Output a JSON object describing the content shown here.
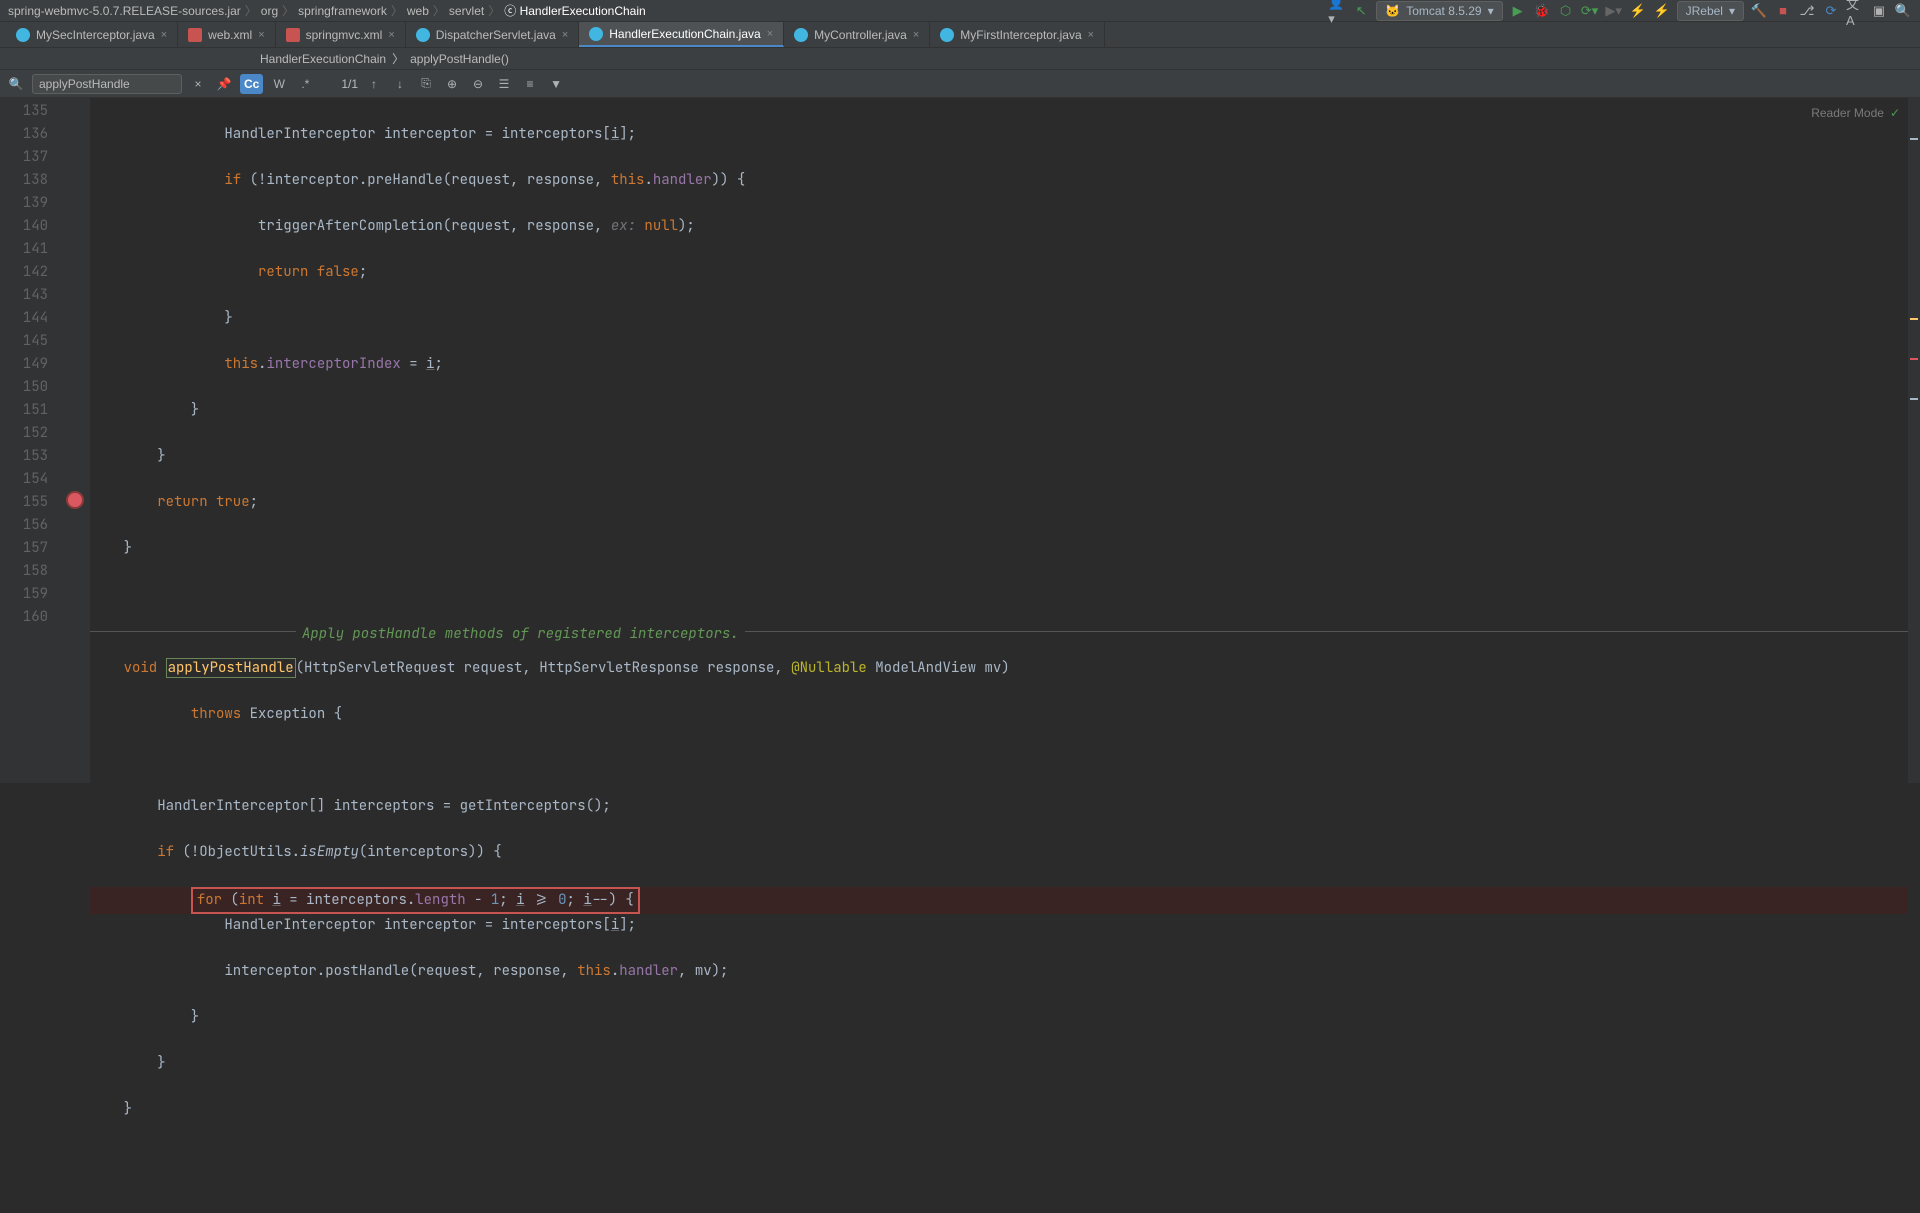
{
  "breadcrumbs": [
    "spring-webmvc-5.0.7.RELEASE-sources.jar",
    "org",
    "springframework",
    "web",
    "servlet",
    "HandlerExecutionChain"
  ],
  "run_config": "Tomcat 8.5.29",
  "jrebel_label": "JRebel",
  "tabs": [
    {
      "label": "MySecInterceptor.java",
      "icon": "java"
    },
    {
      "label": "web.xml",
      "icon": "xml"
    },
    {
      "label": "springmvc.xml",
      "icon": "xml"
    },
    {
      "label": "DispatcherServlet.java",
      "icon": "java"
    },
    {
      "label": "HandlerExecutionChain.java",
      "icon": "java",
      "active": true
    },
    {
      "label": "MyController.java",
      "icon": "java"
    },
    {
      "label": "MyFirstInterceptor.java",
      "icon": "java"
    }
  ],
  "sub_breadcrumb": [
    "HandlerExecutionChain",
    "applyPostHandle()"
  ],
  "find": {
    "query": "applyPostHandle",
    "results": "1/1"
  },
  "reader_mode": "Reader Mode",
  "fold_doc": "Apply postHandle methods of registered interceptors.",
  "line_numbers": [
    "135",
    "136",
    "137",
    "138",
    "139",
    "140",
    "141",
    "142",
    "143",
    "144",
    "145",
    "",
    "149",
    "150",
    "151",
    "152",
    "153",
    "154",
    "155",
    "156",
    "157",
    "158",
    "159",
    "160"
  ],
  "breakpoint_line_index": 17,
  "colors": {
    "keyword": "#cc7832",
    "field": "#9876aa",
    "method": "#ffc66d",
    "annotation": "#bbb529",
    "number": "#6897bb"
  }
}
